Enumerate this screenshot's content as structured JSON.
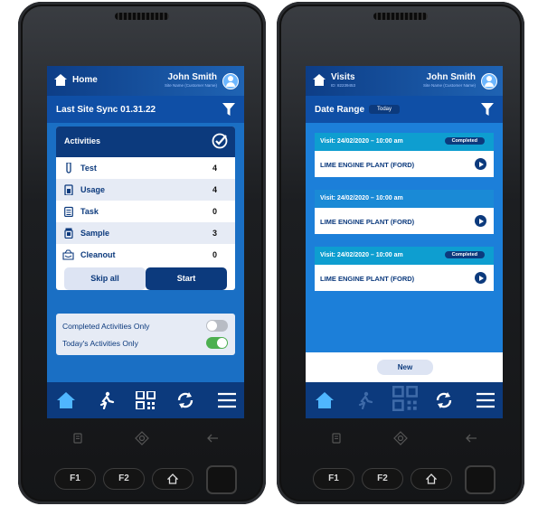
{
  "phone1": {
    "header": {
      "title": "Home",
      "user_name": "John Smith",
      "site_name": "Site Name (Customer Name)"
    },
    "sync_label": "Last Site Sync 01.31.22",
    "activities": {
      "title": "Activities",
      "items": [
        {
          "label": "Test",
          "count": "4",
          "icon": "test-tube-icon"
        },
        {
          "label": "Usage",
          "count": "4",
          "icon": "bottle-icon"
        },
        {
          "label": "Task",
          "count": "0",
          "icon": "clipboard-icon"
        },
        {
          "label": "Sample",
          "count": "3",
          "icon": "sample-jar-icon"
        },
        {
          "label": "Cleanout",
          "count": "0",
          "icon": "cleanout-icon"
        }
      ],
      "skip_label": "Skip all",
      "start_label": "Start"
    },
    "toggles": [
      {
        "label": "Completed Activities Only",
        "on": false
      },
      {
        "label": "Today's Activities Only",
        "on": true
      }
    ]
  },
  "phone2": {
    "header": {
      "title": "Visits",
      "sub": "ID: 82239453",
      "user_name": "John Smith",
      "site_name": "Site Name (Customer Name)"
    },
    "date_range_label": "Date Range",
    "date_range_value": "Today",
    "visits": [
      {
        "date": "Visit: 24/02/2020 – 10:00 am",
        "status": "Completed",
        "site": "LIME ENGINE PLANT (FORD)"
      },
      {
        "date": "Visit: 24/02/2020 – 10:00 am",
        "status": "",
        "site": "LIME ENGINE PLANT (FORD)"
      },
      {
        "date": "Visit: 24/02/2020 – 10:00 am",
        "status": "Completed",
        "site": "LIME ENGINE PLANT (FORD)"
      }
    ],
    "new_label": "New"
  },
  "hardware_keys": {
    "f1": "F1",
    "f2": "F2"
  },
  "colors": {
    "navy": "#0c3a7d",
    "primary_blue": "#1a6fc4",
    "visit_header": "#0e9ed0",
    "toggle_on": "#4caf50"
  },
  "nav_icons": [
    "home-icon",
    "run-icon",
    "qr-code-icon",
    "sync-icon",
    "menu-icon"
  ]
}
